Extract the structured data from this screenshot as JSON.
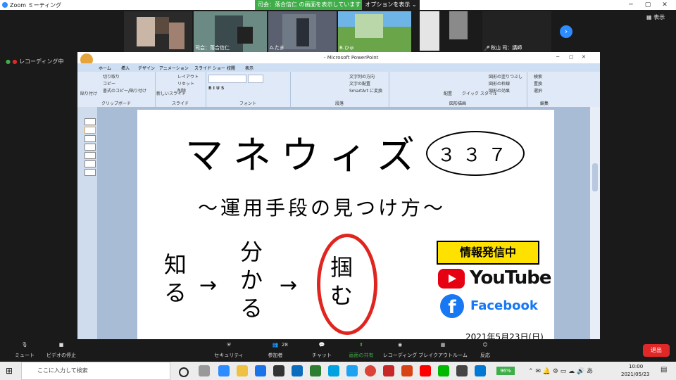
{
  "zoom": {
    "window_title": "Zoom ミーティング",
    "share_banner": "司会：落合信仁 の画面を表示しています",
    "share_options": "オプションを表示",
    "recording": "レコーディング中",
    "view_button": "表示",
    "participants": [
      {
        "name": ""
      },
      {
        "name": "司会：落合信仁"
      },
      {
        "name": "A.たま"
      },
      {
        "name": ""
      },
      {
        "name": "B.ひゅ"
      },
      {
        "name": ""
      },
      {
        "name": "秋山 司：講師"
      }
    ],
    "toolbar": {
      "mute": "ミュート",
      "stop_video": "ビデオの停止",
      "security": "セキュリティ",
      "participants": "参加者",
      "participants_count": "28",
      "chat": "チャット",
      "share_screen": "画面の共有",
      "record": "レコーディング",
      "breakout": "ブレイクアウトルーム",
      "reactions": "反応",
      "exit": "退出"
    }
  },
  "powerpoint": {
    "title": "- Microsoft PowerPoint",
    "tabs": [
      "ホーム",
      "挿入",
      "デザイン",
      "アニメーション",
      "スライド ショー",
      "校閲",
      "表示"
    ],
    "ribbon_groups": [
      "クリップボード",
      "スライド",
      "フォント",
      "段落",
      "図形描画",
      "編集"
    ],
    "clipboard_items": [
      "切り取り",
      "コピー",
      "書式のコピー/貼り付け",
      "貼り付け"
    ],
    "slides_items": [
      "レイアウト",
      "リセット",
      "削除",
      "新しいスライド"
    ],
    "paragraph_items": [
      "文字列の方向",
      "文字の配置",
      "SmartArt に変換"
    ],
    "drawing_items": [
      "配置",
      "クイック スタイル",
      "図形の塗りつぶし",
      "図形の枠線",
      "図形の効果"
    ],
    "editing_items": [
      "検索",
      "置換",
      "選択"
    ]
  },
  "slide": {
    "title": "マネウィズ",
    "number": "３３７",
    "subtitle": "～運用手段の見つけ方～",
    "step1": "知る",
    "arrow1": "→",
    "step2": "分かる",
    "arrow2": "→",
    "step3": "掴む",
    "badge": "情報発信中",
    "youtube": "YouTube",
    "facebook": "Facebook",
    "date": "2021年5月23日(日)"
  },
  "taskbar": {
    "search_placeholder": "ここに入力して検索",
    "battery": "96%",
    "time": "10:00",
    "date": "2021/05/23"
  },
  "colors": {
    "zoom_blue": "#2d8cff",
    "share_green": "#3fae49",
    "circle_red": "#e0241f",
    "badge_yellow": "#ffe100",
    "youtube_red": "#e60012",
    "facebook_blue": "#1877f2",
    "exit_red": "#e02828"
  }
}
